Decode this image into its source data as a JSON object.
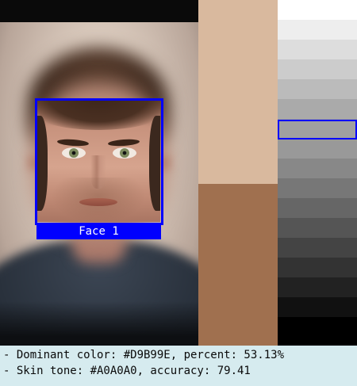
{
  "face": {
    "label": "Face 1"
  },
  "swatches": [
    {
      "color": "#d9b99e",
      "share": 0.5313
    },
    {
      "color": "#a0704f",
      "share": 0.4687
    }
  ],
  "grayscale": {
    "colors": [
      "#ffffff",
      "#eeeeee",
      "#dddddd",
      "#cccccc",
      "#bbbbbb",
      "#aaaaaa",
      "#a0a0a0",
      "#999999",
      "#888888",
      "#777777",
      "#666666",
      "#555555",
      "#444444",
      "#333333",
      "#222222",
      "#111111",
      "#000000"
    ],
    "selected_index": 6,
    "highlight_color": "#0000ff"
  },
  "info": {
    "line1": "- Dominant color: #D9B99E, percent: 53.13%",
    "line2": "- Skin tone: #A0A0A0, accuracy: 79.41"
  }
}
